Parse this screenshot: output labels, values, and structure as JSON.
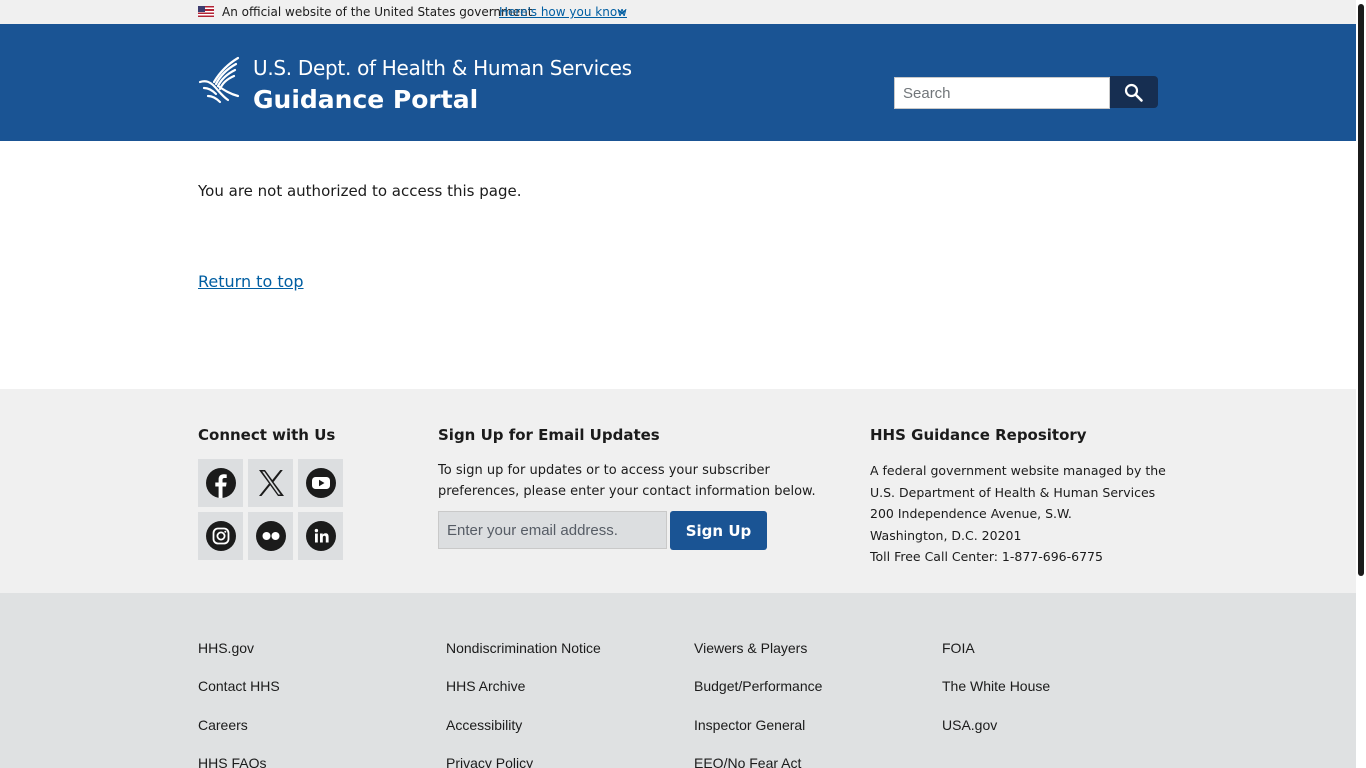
{
  "banner": {
    "official_text": "An official website of the United States government",
    "how_you_know": "Here's how you know"
  },
  "header": {
    "agency": "U.S. Dept. of Health & Human Services",
    "portal_title": "Guidance Portal",
    "search_placeholder": "Search"
  },
  "main": {
    "message": "You are not authorized to access this page.",
    "return_top": "Return to top"
  },
  "footer": {
    "connect_heading": "Connect with Us",
    "social": [
      "facebook-icon",
      "x-icon",
      "youtube-icon",
      "instagram-icon",
      "flickr-icon",
      "linkedin-icon"
    ],
    "email_heading": "Sign Up for Email Updates",
    "email_desc": "To sign up for updates or to access your subscriber preferences, please enter your contact information below.",
    "email_placeholder": "Enter your email address.",
    "signup_label": "Sign Up",
    "repo_heading": "HHS Guidance Repository",
    "repo_lines": [
      "A federal government website managed by the",
      "U.S. Department of Health & Human Services",
      "200 Independence Avenue, S.W.",
      "Washington, D.C. 20201",
      "Toll Free Call Center: 1-877-696-6775"
    ]
  },
  "footer_links": {
    "col1": [
      "HHS.gov",
      "Contact HHS",
      "Careers",
      "HHS FAQs"
    ],
    "col2": [
      "Nondiscrimination Notice",
      "HHS Archive",
      "Accessibility",
      "Privacy Policy"
    ],
    "col3": [
      "Viewers & Players",
      "Budget/Performance",
      "Inspector General",
      "EEO/No Fear Act"
    ],
    "col4": [
      "FOIA",
      "The White House",
      "USA.gov"
    ]
  },
  "colors": {
    "header_bg": "#1a5494",
    "search_button": "#162e51",
    "link": "#005ea2",
    "footer_primary_bg": "#f0f0f0",
    "footer_links_bg": "#dfe1e2"
  }
}
